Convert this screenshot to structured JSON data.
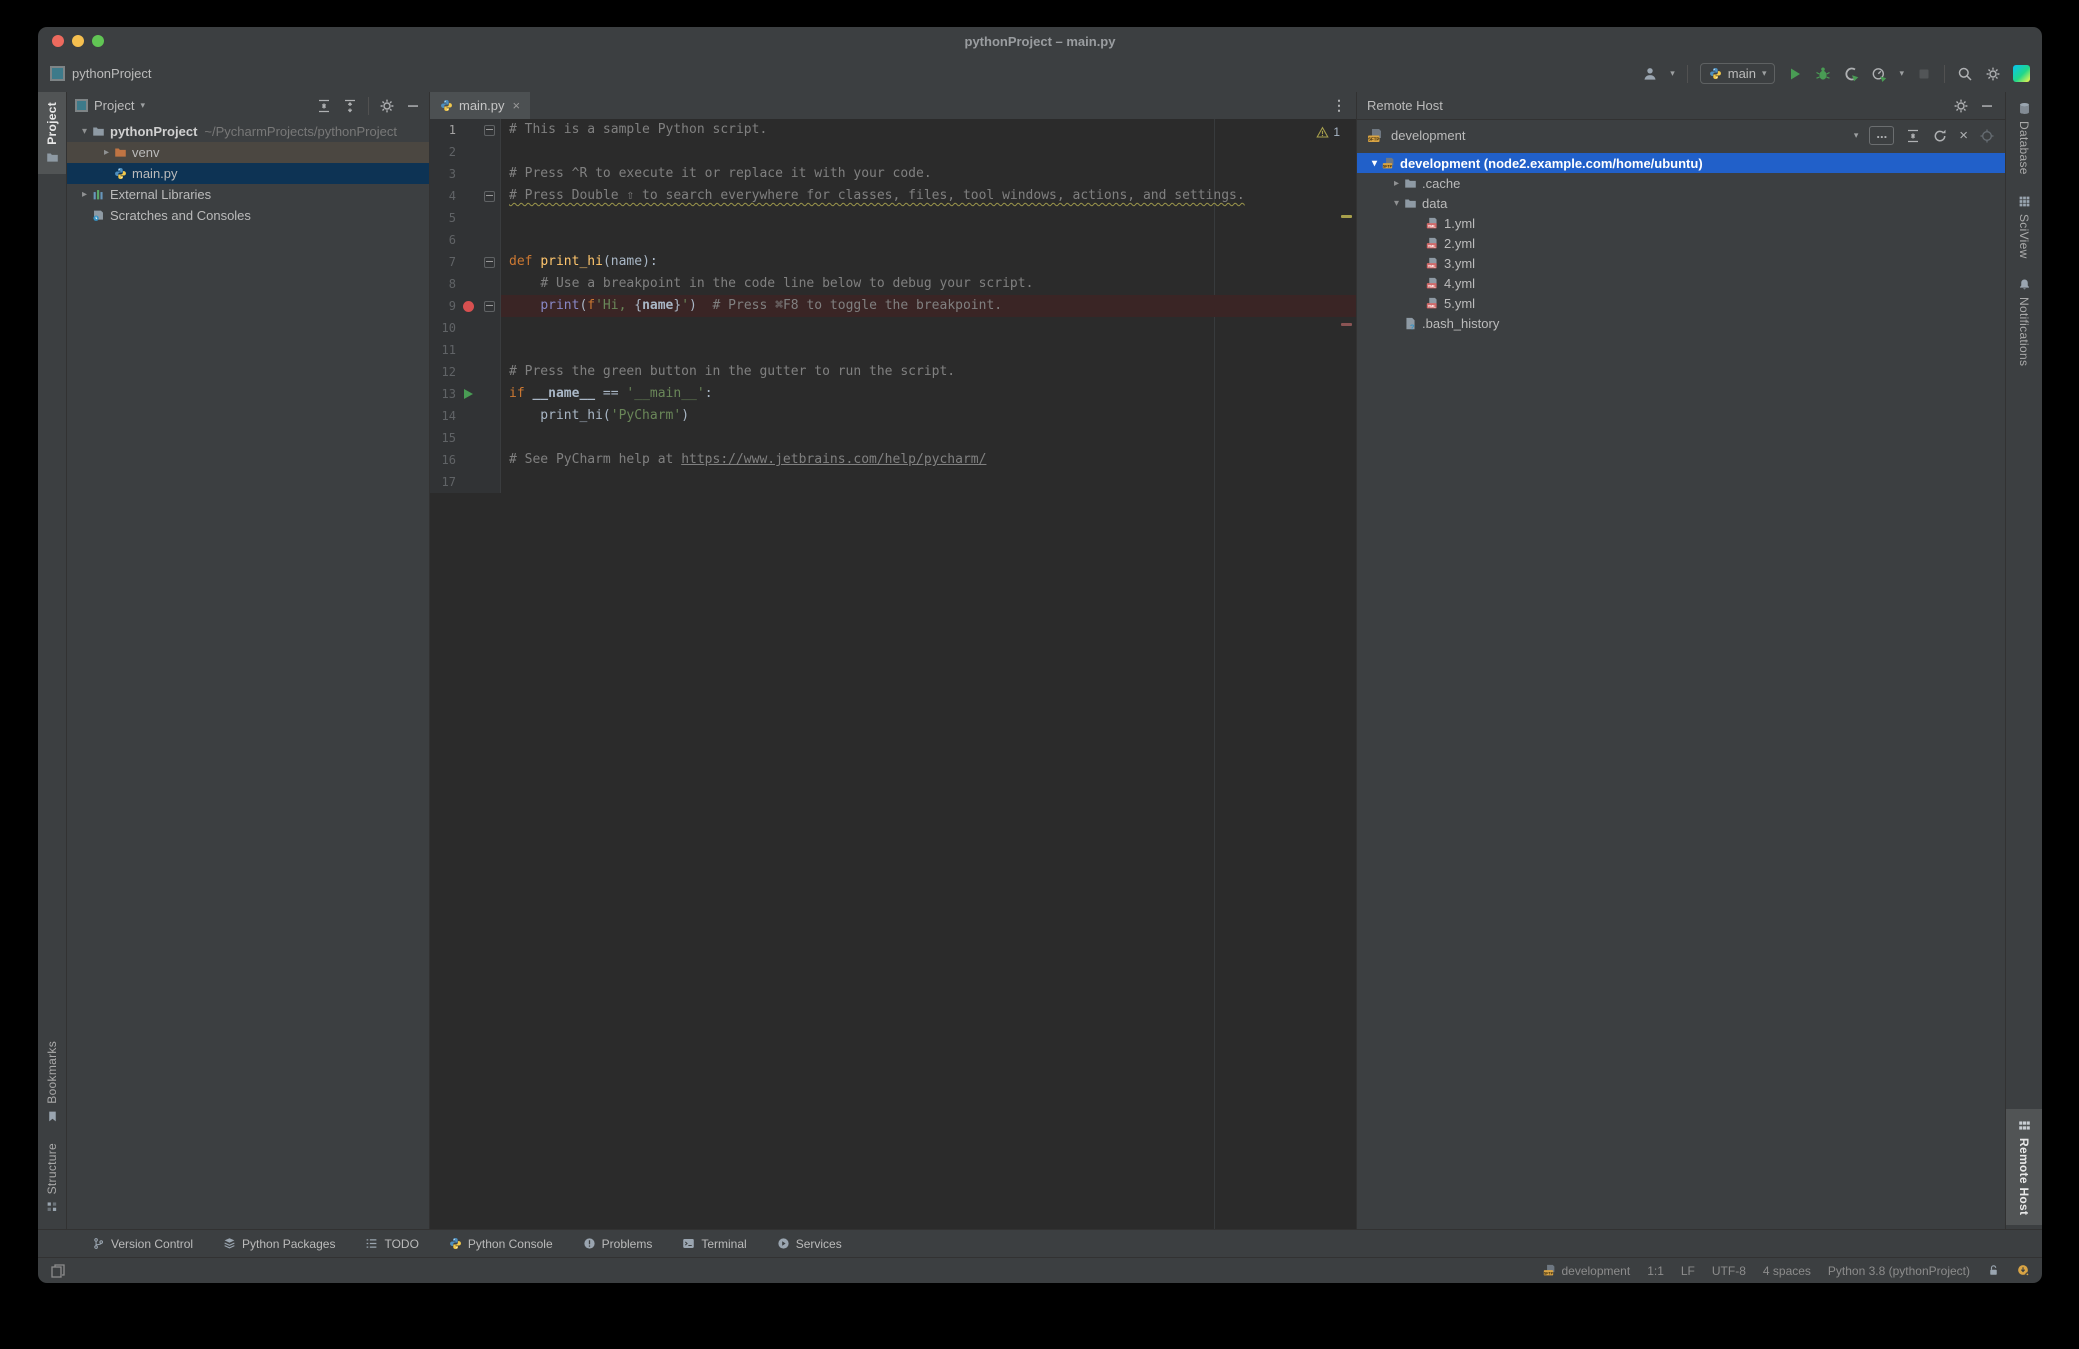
{
  "window": {
    "title": "pythonProject – main.py"
  },
  "toolbar": {
    "project_label": "pythonProject",
    "run_config": "main"
  },
  "tool_stripes": {
    "left_top": [
      {
        "label": "Project",
        "icon": "folder",
        "active": true
      }
    ],
    "left_bottom": [
      {
        "label": "Bookmarks",
        "icon": "bookmark"
      },
      {
        "label": "Structure",
        "icon": "structure"
      }
    ],
    "right_top": [
      {
        "label": "Database",
        "icon": "database"
      },
      {
        "label": "SciView",
        "icon": "sciview"
      },
      {
        "label": "Notifications",
        "icon": "bell"
      }
    ],
    "right_bottom": [
      {
        "label": "Remote Host",
        "icon": "remote-grid",
        "active": true
      }
    ]
  },
  "project_panel": {
    "title": "Project",
    "tree": [
      {
        "label": "pythonProject",
        "path": "~/PycharmProjects/pythonProject",
        "icon": "folder",
        "chev": "down",
        "depth": 0,
        "bold": true
      },
      {
        "label": "venv",
        "icon": "folder-orange",
        "chev": "right",
        "depth": 1,
        "cls": "row-hover"
      },
      {
        "label": "main.py",
        "icon": "python",
        "depth": 1,
        "cls": "row-active"
      },
      {
        "label": "External Libraries",
        "icon": "ext-lib",
        "chev": "right",
        "depth": 0
      },
      {
        "label": "Scratches and Consoles",
        "icon": "scratches",
        "depth": 0
      }
    ]
  },
  "editor": {
    "tab_label": "main.py",
    "warning_count": "1",
    "lines": [
      {
        "g": "fold",
        "tok": [
          [
            "c",
            "# This is a sample Python script."
          ]
        ]
      },
      {
        "tok": []
      },
      {
        "tok": [
          [
            "c",
            "# Press ^R to execute it or replace it with your code."
          ]
        ]
      },
      {
        "g": "end",
        "tok": [
          [
            "w",
            "# Press Double ⇧ to search everywhere for classes, files, tool windows, actions, and settings."
          ]
        ]
      },
      {
        "tok": []
      },
      {
        "tok": []
      },
      {
        "g": "fold",
        "tok": [
          [
            "k",
            "def "
          ],
          [
            "f",
            "print_hi"
          ],
          [
            "t",
            "(name):"
          ]
        ]
      },
      {
        "tok": [
          [
            "t",
            "    "
          ],
          [
            "c",
            "# Use a breakpoint in the code line below to debug your script."
          ]
        ]
      },
      {
        "g": "end",
        "bp": true,
        "hl": true,
        "tok": [
          [
            "t",
            "    "
          ],
          [
            "b",
            "print"
          ],
          [
            "t",
            "("
          ],
          [
            "k",
            "f"
          ],
          [
            "s",
            "'Hi, "
          ],
          [
            "t",
            "{"
          ],
          [
            "d",
            "name"
          ],
          [
            "t",
            "}"
          ],
          [
            "s",
            "'"
          ],
          [
            "t",
            ")  "
          ],
          [
            "c",
            "# Press ⌘F8 to toggle the breakpoint."
          ]
        ]
      },
      {
        "tok": []
      },
      {
        "tok": []
      },
      {
        "tok": [
          [
            "c",
            "# Press the green button in the gutter to run the script."
          ]
        ]
      },
      {
        "run": true,
        "tok": [
          [
            "k",
            "if "
          ],
          [
            "d",
            "__name__"
          ],
          [
            "t",
            " == "
          ],
          [
            "s",
            "'__main__'"
          ],
          [
            "t",
            ":"
          ]
        ]
      },
      {
        "tok": [
          [
            "t",
            "    print_hi("
          ],
          [
            "s",
            "'PyCharm'"
          ],
          [
            "t",
            ")"
          ]
        ]
      },
      {
        "tok": []
      },
      {
        "tok": [
          [
            "c",
            "# See PyCharm help at "
          ],
          [
            "l",
            "https://www.jetbrains.com/help/pycharm/"
          ]
        ]
      },
      {
        "tok": []
      }
    ]
  },
  "remote_panel": {
    "title": "Remote Host",
    "server_label": "development",
    "more_label": "...",
    "tree": [
      {
        "label": "development (node2.example.com/home/ubuntu)",
        "icon": "sftp",
        "chev": "down",
        "depth": 0,
        "cls": "row-selected"
      },
      {
        "label": ".cache",
        "icon": "folder",
        "chev": "right",
        "depth": 1
      },
      {
        "label": "data",
        "icon": "folder",
        "chev": "down",
        "depth": 1
      },
      {
        "label": "1.yml",
        "icon": "yml",
        "depth": 2
      },
      {
        "label": "2.yml",
        "icon": "yml",
        "depth": 2
      },
      {
        "label": "3.yml",
        "icon": "yml",
        "depth": 2
      },
      {
        "label": "4.yml",
        "icon": "yml",
        "depth": 2
      },
      {
        "label": "5.yml",
        "icon": "yml",
        "depth": 2
      },
      {
        "label": ".bash_history",
        "icon": "file-unknown",
        "depth": 1
      }
    ]
  },
  "toolwindow_bar": [
    {
      "label": "Version Control",
      "icon": "branch"
    },
    {
      "label": "Python Packages",
      "icon": "packages"
    },
    {
      "label": "TODO",
      "icon": "todo"
    },
    {
      "label": "Python Console",
      "icon": "python"
    },
    {
      "label": "Problems",
      "icon": "problems"
    },
    {
      "label": "Terminal",
      "icon": "terminal"
    },
    {
      "label": "Services",
      "icon": "services"
    }
  ],
  "status_bar": {
    "left_icon": "layout",
    "items": [
      {
        "icon": "sftp",
        "label": "development"
      },
      {
        "label": "1:1"
      },
      {
        "label": "LF"
      },
      {
        "label": "UTF-8"
      },
      {
        "label": "4 spaces"
      },
      {
        "label": "Python 3.8 (pythonProject)"
      },
      {
        "icon": "lock-open"
      },
      {
        "icon": "sync"
      }
    ]
  },
  "colors": {
    "selection_blue": "#2160C9",
    "breakpoint_red": "#D75050",
    "breakpoint_line_bg": "#3A2525",
    "run_green": "#499C54",
    "warning_yellow": "#A8A04C",
    "editor_bg": "#2B2B2B",
    "panel_bg": "#3C3F41",
    "accent_orange_folder": "#C07443"
  }
}
